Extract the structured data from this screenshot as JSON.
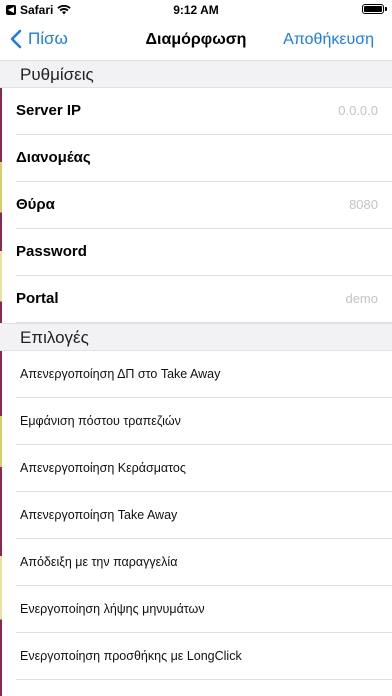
{
  "status_bar": {
    "back_app": "Safari",
    "time": "9:12 AM"
  },
  "nav": {
    "back_label": "Πίσω",
    "title": "Διαμόρφωση",
    "save_label": "Αποθήκευση"
  },
  "settings": {
    "header": "Ρυθμίσεις",
    "rows": [
      {
        "label": "Server IP",
        "placeholder": "0.0.0.0"
      },
      {
        "label": "Διανομέας",
        "placeholder": ""
      },
      {
        "label": "Θύρα",
        "placeholder": "8080"
      },
      {
        "label": "Password",
        "placeholder": ""
      },
      {
        "label": "Portal",
        "placeholder": "demo"
      }
    ]
  },
  "options": {
    "header": "Επιλογές",
    "items": [
      "Απενεργοποίηση ΔΠ στο Take Away",
      "Εμφάνιση πόστου τραπεζιών",
      "Απενεργοποίηση Κεράσματος",
      "Απενεργοποίηση Take Away",
      "Απόδειξη με την παραγγελία",
      "Ενεργοποίηση λήψης μηνυμάτων",
      "Ενεργοποίηση προσθήκης με LongClick"
    ]
  },
  "colors": {
    "accent": "#1a7cf5",
    "placeholder": "#c4c4c8",
    "section_bg": "#f2f2f4"
  }
}
